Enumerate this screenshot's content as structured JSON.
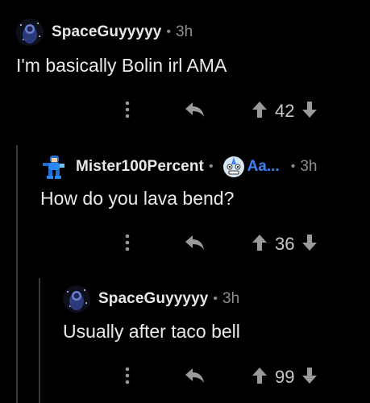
{
  "comments": [
    {
      "username": "SpaceGuyyyyy",
      "separator": "•",
      "age": "3h",
      "body": "I'm basically Bolin irl AMA",
      "score": "42",
      "avatar_icon": "space-avatar-icon"
    },
    {
      "username": "Mister100Percent",
      "separator": "•",
      "flair_text": "Aa...",
      "age": "3h",
      "body": "How do you lava bend?",
      "score": "36",
      "avatar_icon": "megaman-avatar-icon",
      "flair_icon": "aang-flair-icon"
    },
    {
      "username": "SpaceGuyyyyy",
      "separator": "•",
      "age": "3h",
      "body": "Usually after taco bell",
      "score": "99",
      "avatar_icon": "space-avatar-icon"
    }
  ],
  "colors": {
    "background": "#000000",
    "text": "#e9e9e9",
    "muted": "#8f8f8f",
    "flair": "#3b82f6",
    "thread_line": "#3a3a3a"
  }
}
